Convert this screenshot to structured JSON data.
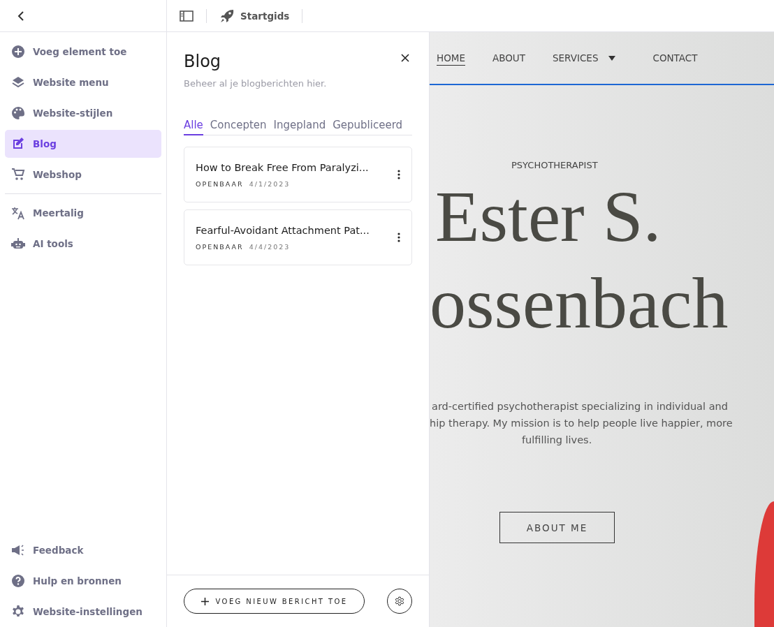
{
  "topbar": {
    "guide_label": "Startgids"
  },
  "sidebar": {
    "groups": [
      [
        {
          "label": "Voeg element toe",
          "selected": false
        },
        {
          "label": "Website menu",
          "selected": false
        },
        {
          "label": "Website-stijlen",
          "selected": false
        },
        {
          "label": "Blog",
          "selected": true
        },
        {
          "label": "Webshop",
          "selected": false
        }
      ],
      [
        {
          "label": "Meertalig",
          "selected": false
        },
        {
          "label": "AI tools",
          "selected": false
        }
      ]
    ],
    "bottom_items": [
      {
        "label": "Feedback",
        "selected": false
      },
      {
        "label": "Hulp en bronnen",
        "selected": false
      },
      {
        "label": "Website-instellingen",
        "selected": false
      }
    ]
  },
  "blog_panel": {
    "title": "Blog",
    "subtitle": "Beheer al je blogberichten hier.",
    "tabs": [
      {
        "label": "Alle",
        "selected": true
      },
      {
        "label": "Concepten",
        "selected": false
      },
      {
        "label": "Ingepland",
        "selected": false
      },
      {
        "label": "Gepubliceerd",
        "selected": false
      }
    ],
    "posts": [
      {
        "title": "How to Break Free From Paralyzi...",
        "status": "OPENBAAR",
        "date": "4/1/2023"
      },
      {
        "title": "Fearful-Avoidant Attachment Pat...",
        "status": "OPENBAAR",
        "date": "4/4/2023"
      }
    ],
    "add_button": "VOEG NIEUW BERICHT TOE"
  },
  "preview": {
    "nav": [
      {
        "label": "HOME",
        "selected": true,
        "dropdown": false
      },
      {
        "label": "ABOUT",
        "selected": false,
        "dropdown": false
      },
      {
        "label": "SERVICES",
        "selected": false,
        "dropdown": true
      },
      {
        "label": "CONTACT",
        "selected": false,
        "dropdown": false
      }
    ],
    "eyebrow": "PSYCHOTHERAPIST",
    "name_lines": [
      "Ester S.",
      "ossenbach"
    ],
    "intro_lines": [
      "ard-certified psychotherapist specializing in individual and",
      "hip therapy. My mission is to help people live happier, more",
      "fulfilling lives."
    ],
    "cta": "ABOUT ME"
  }
}
